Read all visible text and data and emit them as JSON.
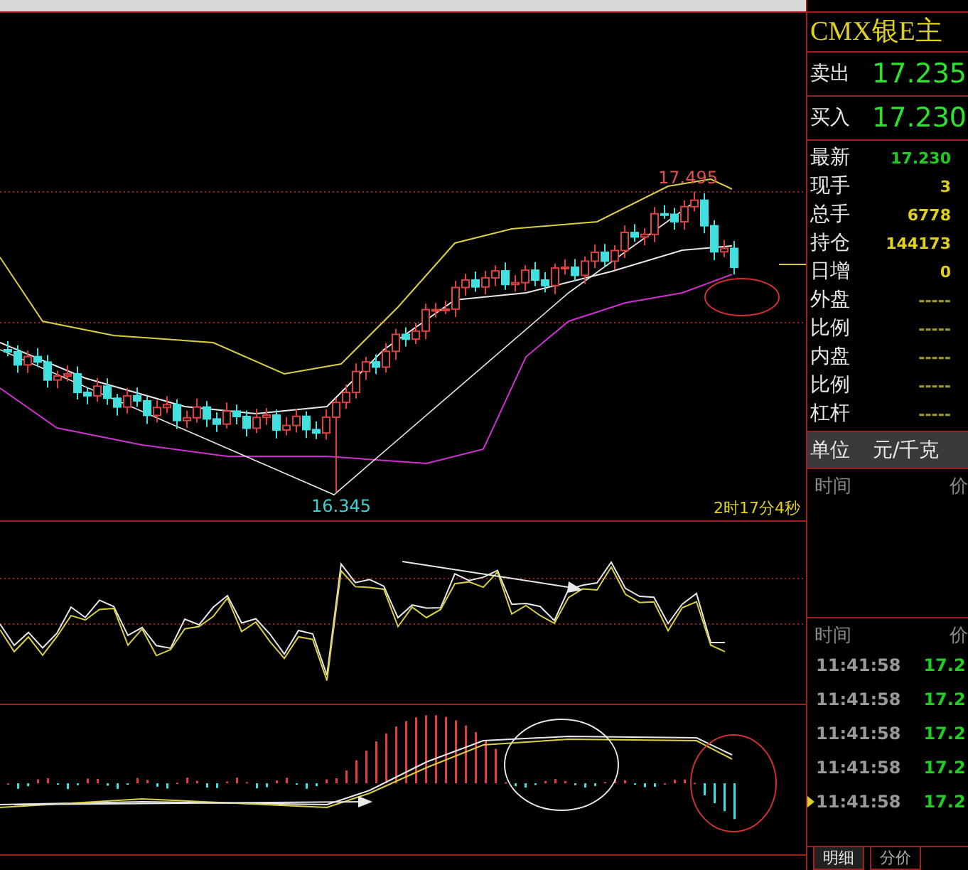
{
  "chart": {
    "high_label": "17.495",
    "low_label": "16.345",
    "countdown": "2时17分4秒"
  },
  "quote": {
    "title": "CMX银E主",
    "ask_label": "卖出",
    "ask": "17.235",
    "bid_label": "买入",
    "bid": "17.230",
    "stats": [
      {
        "label": "最新",
        "value": "17.230",
        "color": "#22cc22"
      },
      {
        "label": "现手",
        "value": "3",
        "color": "#e0d020"
      },
      {
        "label": "总手",
        "value": "6778",
        "color": "#e0d020"
      },
      {
        "label": "持仓",
        "value": "144173",
        "color": "#e0d020"
      },
      {
        "label": "日增",
        "value": "0",
        "color": "#e0d020"
      },
      {
        "label": "外盘",
        "value": "-----",
        "color": "#a09a30"
      },
      {
        "label": "比例",
        "value": "-----",
        "color": "#a09a30"
      },
      {
        "label": "内盘",
        "value": "-----",
        "color": "#a09a30"
      },
      {
        "label": "比例",
        "value": "-----",
        "color": "#a09a30"
      },
      {
        "label": "杠杆",
        "value": "-----",
        "color": "#a09a30"
      }
    ],
    "unit_label": "单位",
    "unit": "元/千克"
  },
  "ticks_panel": {
    "headers": [
      "时间",
      "价"
    ]
  },
  "trades": {
    "headers": [
      "时间",
      "价"
    ],
    "rows": [
      {
        "time": "11:41:58",
        "price": "17.2",
        "selected": false
      },
      {
        "time": "11:41:58",
        "price": "17.2",
        "selected": false
      },
      {
        "time": "11:41:58",
        "price": "17.2",
        "selected": false
      },
      {
        "time": "11:41:58",
        "price": "17.2",
        "selected": false
      },
      {
        "time": "11:41:58",
        "price": "17.2",
        "selected": true
      }
    ]
  },
  "tabs": [
    {
      "label": "明细",
      "selected": true
    },
    {
      "label": "分价",
      "selected": false
    }
  ]
}
